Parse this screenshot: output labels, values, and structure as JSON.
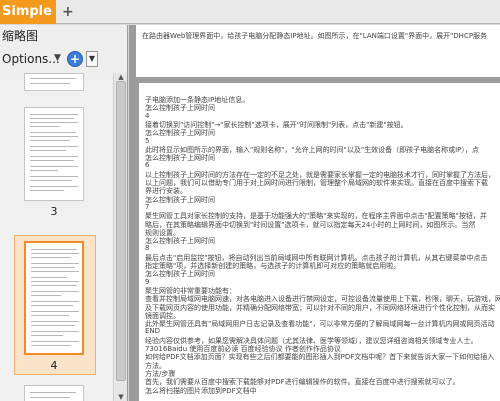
{
  "tab": {
    "title": "Simple",
    "modified_mark": "*",
    "close": "×"
  },
  "new_tab": "+",
  "panel": {
    "title": "缩略图",
    "options_label": "Options...",
    "options_caret": "▼",
    "zoom_icon": "+",
    "zoom_menu": "▼"
  },
  "thumbnails": [
    {
      "label": "3"
    },
    {
      "label": "4"
    }
  ],
  "document": {
    "top_line": "在路由器Web管理界面中，给孩子电脑分配静态IP地址。如图所示，在\"LAN端口设置\"界面中，展开\"DHCP服务",
    "lines": [
      "子电脑添加一条静态IP地址信息。",
      "怎么控制孩子上网时间",
      "4",
      "接着切换到\"访问控制\"→\"家长控制\"选项卡，展开\"时间限制\"列表，点击\"新建\"按钮。",
      "怎么控制孩子上网时间",
      "5",
      "此时将显示如图所示的界面，输入\"规则名称\"，\"允许上网的时间\"以及\"生效设备（即孩子电脑名称或IP），点",
      "怎么控制孩子上网时间",
      "6",
      "以上控制孩子上网时间的方法存在一定的不足之处，就是需要家长掌握一定的电脑技术才行，同时掌握了方法后，",
      "以上问题，我们可以借助专门用于对上网时间进行限制，管理整个局域网的软件来实现。直接在百度中搜索下载",
      "界进行安装。",
      "怎么控制孩子上网时间",
      "7",
      "聚生网管工具对家长控制的支持，是基于功能强大的\"策略\"来实现的，在程序主界面中点击\"配置策略\"按钮，并",
      "略后，在其策略编辑界面中切换到\"时间设置\"选项卡，就可以指定每天24小时的上网时间，如图所示。当然",
      "规则设置。",
      "怎么控制孩子上网时间",
      "8",
      "最后点击\"启用监控\"按钮，将自动列出当前局域网中所有联网计算机。点击孩子的计算机，从其右键菜单中点击",
      "指定策略\"项，并选择新创建的策略，与选孩子的计算机即可对应的策略就启用啦。",
      "怎么控制孩子上网时间",
      "9",
      "聚生网管的非常重要功能有：",
      "查看并控制局域网电脑网速，对各电脑进入设备进行禁网设定，可控设备流量使用上下载，秒限，聊天，玩游戏，网页",
      "及下载网页内容的使用功能，并精确分配网络带宽；可以针对不同的用户，不同网络环境进行个性化控制，从而实",
      "镜面调控。",
      "此外聚生网管还具有\"局域网用户日志记录及查看功能\"，可以非常方便的了解局域网每一台计算机内网或网页活动",
      "END",
      "经验内容仅供参考，如果您需解决具体问题（尤其法律、医学等领域），建议您详细咨询相关领域专业人士。",
      "73016Baidu 使用百度前必读 百度经验协议 作者创作作品协议",
      "如何给PDF文档添加页面？实现有些之后们都要能的图形插入到PDF文档中呢？首下来就告诉大家一下如何给插入",
      "方法。",
      "方法/步骤",
      "首先，我们需要从百度中搜索下载能够对PDF进行编辑操作的软件。直接在百度中进行搜索就可以了。",
      "怎么将扫描的图片添加到PDF文档中"
    ]
  }
}
